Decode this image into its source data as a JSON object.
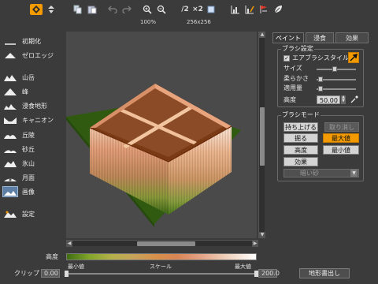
{
  "toolbar": {
    "zoom_level": "100%",
    "resolution": "256x256",
    "scale_button_label": "×2",
    "halve_label": "/2",
    "icons": [
      "select-tool-icon",
      "pin-icon",
      "copy-icon",
      "paste-icon",
      "undo-icon",
      "redo-icon",
      "zoom-in-icon",
      "zoom-out-icon",
      "resize-half-icon",
      "resize-double-icon",
      "square-icon",
      "histogram-icon",
      "histogram-edit-icon",
      "flag-icon",
      "leaf-icon"
    ]
  },
  "sidebar": {
    "items": [
      {
        "label": "初期化",
        "icon": "reset-icon"
      },
      {
        "label": "ゼロエッジ",
        "icon": "zero-edge-icon"
      },
      {
        "label": "山岳",
        "icon": "mountains-icon"
      },
      {
        "label": "峰",
        "icon": "peak-icon"
      },
      {
        "label": "浸食地形",
        "icon": "erosion-icon"
      },
      {
        "label": "キャニオン",
        "icon": "canyon-icon"
      },
      {
        "label": "丘陵",
        "icon": "hills-icon"
      },
      {
        "label": "砂丘",
        "icon": "dunes-icon"
      },
      {
        "label": "氷山",
        "icon": "iceberg-icon"
      },
      {
        "label": "月面",
        "icon": "lunar-icon"
      },
      {
        "label": "画像",
        "icon": "image-icon",
        "active": true
      },
      {
        "label": "設定",
        "icon": "settings-icon"
      }
    ]
  },
  "panel": {
    "tabs": [
      {
        "label": "ペイント",
        "active": true
      },
      {
        "label": "浸食",
        "active": false
      },
      {
        "label": "効果",
        "active": false
      }
    ],
    "brush_settings": {
      "title": "ブラシ設定",
      "airbrush_label": "エアブラシスタイル",
      "airbrush_checked": true,
      "size_label": "サイズ",
      "size_value": 0.55,
      "softness_label": "柔らかさ",
      "softness_value": 0.12,
      "amount_label": "適用量",
      "amount_value": 0.12,
      "height_label": "高度",
      "height_value": "50.00"
    },
    "brush_mode": {
      "title": "ブラシモード",
      "buttons": [
        {
          "label": "持ち上げる",
          "state": "normal"
        },
        {
          "label": "取り消し",
          "state": "disabled"
        },
        {
          "label": "掘る",
          "state": "normal"
        },
        {
          "label": "最大値",
          "state": "on"
        },
        {
          "label": "高度",
          "state": "normal"
        },
        {
          "label": "最小値",
          "state": "normal"
        },
        {
          "label": "効果",
          "state": "normal"
        }
      ],
      "dropdown_value": "暗い砂"
    }
  },
  "bottom": {
    "gradient_label": "高度",
    "min_label": "最小値",
    "scale_label": "スケール",
    "max_label": "最大値",
    "clip_label": "クリップ",
    "clip_min": "0.00",
    "clip_max": "200.0",
    "export_label": "地形書出し"
  }
}
